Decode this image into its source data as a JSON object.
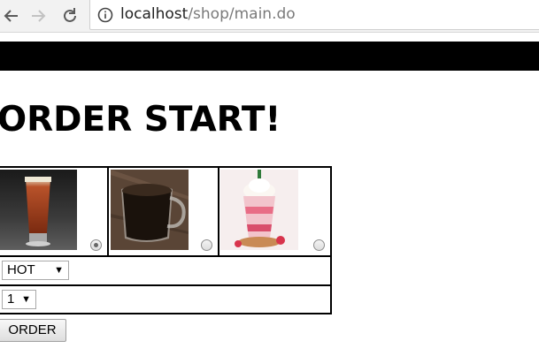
{
  "browser": {
    "url_host": "localhost",
    "url_path": "/shop/main.do",
    "icons": {
      "back": "arrow-left-icon",
      "forward": "arrow-right-icon",
      "reload": "reload-icon",
      "info": "info-icon"
    }
  },
  "page": {
    "title": "ORDER START!"
  },
  "products": [
    {
      "image": "iced-tea-glass",
      "selected": true
    },
    {
      "image": "hot-coffee-mug",
      "selected": false
    },
    {
      "image": "strawberry-frappuccino",
      "selected": false
    }
  ],
  "form": {
    "temperature_value": "HOT",
    "quantity_value": "1",
    "order_label": "ORDER"
  },
  "colors": {
    "top_bar": "#000000",
    "text": "#000000"
  }
}
